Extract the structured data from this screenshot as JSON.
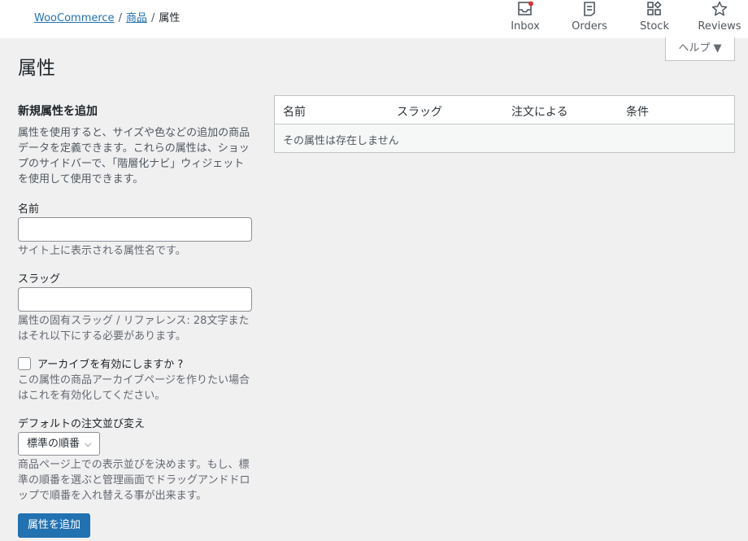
{
  "breadcrumb": {
    "root": "WooCommerce",
    "separator": "/",
    "parent": "商品",
    "current": "属性"
  },
  "activity": {
    "inbox": "Inbox",
    "orders": "Orders",
    "stock": "Stock",
    "reviews": "Reviews"
  },
  "help_tab": "ヘルプ ▼",
  "page_title": "属性",
  "form": {
    "heading": "新規属性を追加",
    "intro": "属性を使用すると、サイズや色などの追加の商品データを定義できます。これらの属性は、ショップのサイドバーで、「階層化ナビ」ウィジェットを使用して使用できます。",
    "name_label": "名前",
    "name_value": "",
    "name_desc": "サイト上に表示される属性名です。",
    "slug_label": "スラッグ",
    "slug_value": "",
    "slug_desc": "属性の固有スラッグ / リファレンス: 28文字またはそれ以下にする必要があります。",
    "archive_label": "アーカイブを有効にしますか ?",
    "archive_desc": "この属性の商品アーカイブページを作りたい場合はこれを有効化してください。",
    "order_label": "デフォルトの注文並び変え",
    "order_value": "標準の順番",
    "order_desc": "商品ページ上での表示並びを決めます。もし、標準の順番を選ぶと管理画面でドラッグアンドドロップで順番を入れ替える事が出来ます。",
    "submit_label": "属性を追加"
  },
  "table": {
    "columns": [
      "名前",
      "スラッグ",
      "注文による",
      "条件"
    ],
    "empty_message": "その属性は存在しません"
  },
  "colors": {
    "accent": "#2271b1",
    "notification_dot": "#d63638"
  }
}
